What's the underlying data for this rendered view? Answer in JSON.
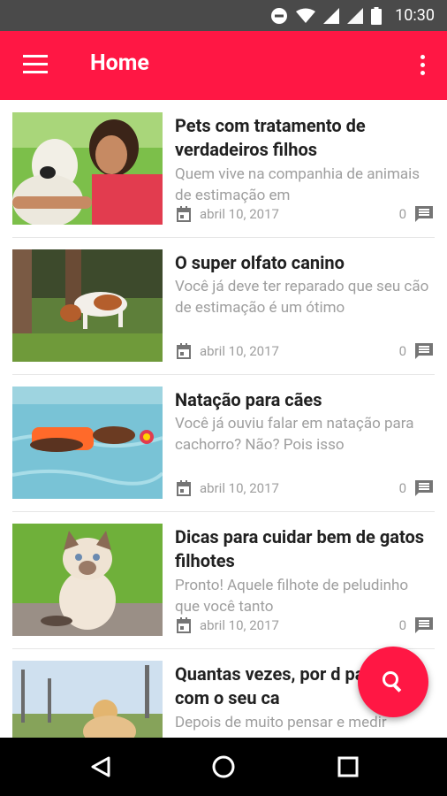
{
  "status_bar": {
    "time": "10:30",
    "icons": [
      "do-not-disturb-icon",
      "wifi-icon",
      "signal-icon",
      "signal-icon",
      "battery-icon"
    ]
  },
  "app_bar": {
    "title": "Home",
    "background_color": "#ff1744",
    "icons": [
      "menu-icon",
      "more-vert-icon"
    ]
  },
  "posts": [
    {
      "title": "Pets com tratamento de verdadeiros filhos",
      "excerpt": "Quem vive na companhia de animais de estimação em",
      "date": "abril 10, 2017",
      "comments": "0",
      "thumbnail": "woman-hugging-dog"
    },
    {
      "title": "O super olfato canino",
      "excerpt": "Você já deve ter reparado que seu cão de estimação é um ótimo",
      "date": "abril 10, 2017",
      "comments": "0",
      "thumbnail": "dog-sniffing-grass"
    },
    {
      "title": "Natação para cães",
      "excerpt": "Você já ouviu falar em natação para cachorro? Não? Pois isso",
      "date": "abril 10, 2017",
      "comments": "0",
      "thumbnail": "dog-swimming-with-vest"
    },
    {
      "title": "Dicas para cuidar bem de gatos filhotes",
      "excerpt": "Pronto! Aquele filhote de peludinho que você tanto",
      "date": "abril 10, 2017",
      "comments": "0",
      "thumbnail": "kitten-sitting"
    },
    {
      "title": "Quantas vezes, por d passear com o seu ca",
      "excerpt": "Depois de muito pensar e medir",
      "thumbnail": "dog-in-park"
    }
  ],
  "fab": {
    "icon": "search-icon",
    "color": "#ff1744"
  },
  "nav_bar": {
    "icons": [
      "back-icon",
      "home-icon",
      "recents-icon"
    ]
  }
}
